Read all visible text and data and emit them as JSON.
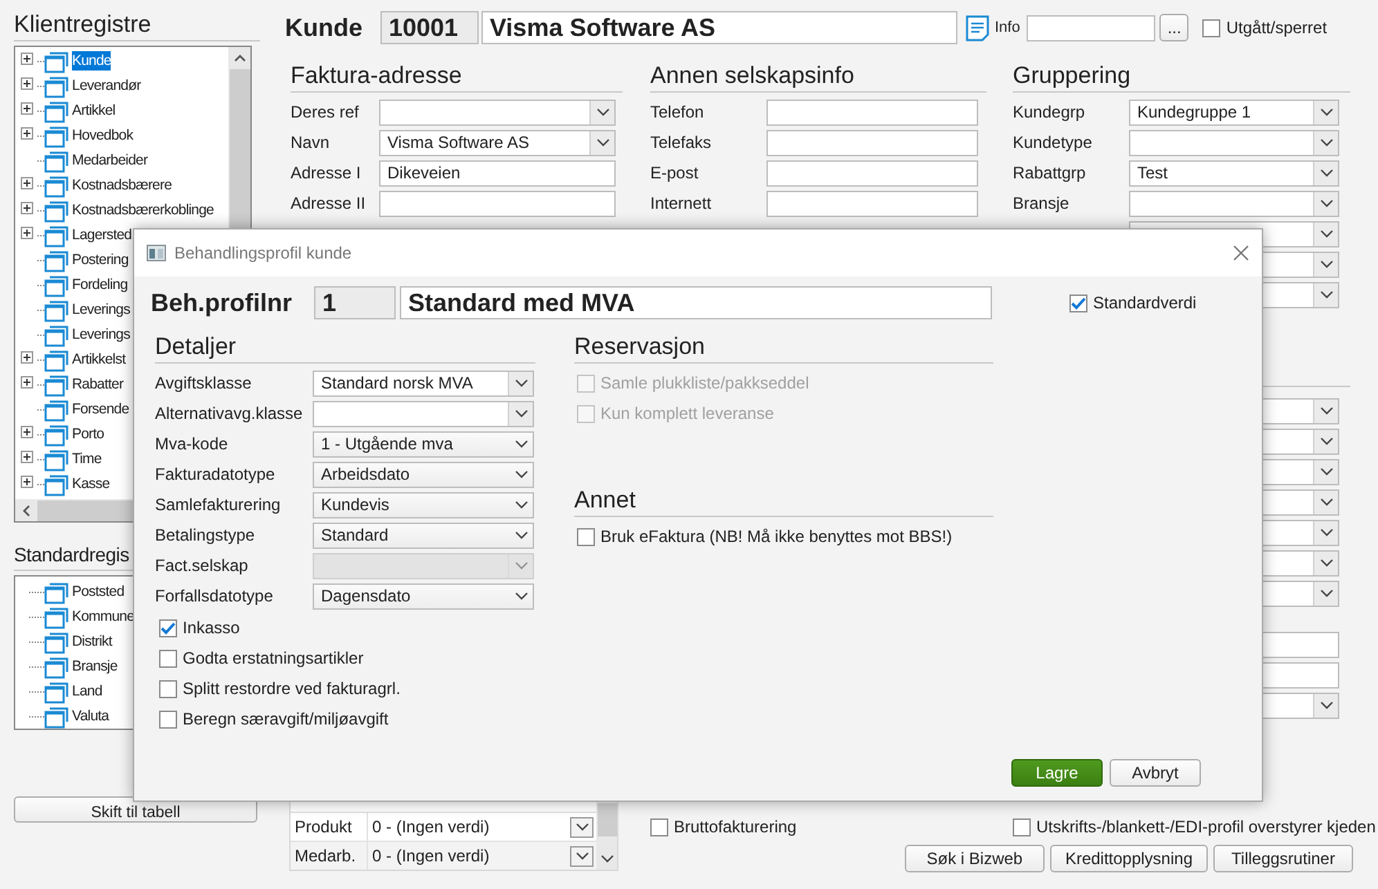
{
  "left_panel": {
    "heading": "Klientregistre",
    "tree": [
      {
        "label": "Kunde",
        "expandable": true,
        "selected": true
      },
      {
        "label": "Leverandør",
        "expandable": true,
        "selected": false
      },
      {
        "label": "Artikkel",
        "expandable": true,
        "selected": false
      },
      {
        "label": "Hovedbok",
        "expandable": true,
        "selected": false
      },
      {
        "label": "Medarbeider",
        "expandable": false,
        "selected": false
      },
      {
        "label": "Kostnadsbærere",
        "expandable": true,
        "selected": false
      },
      {
        "label": "Kostnadsbærerkoblinge",
        "expandable": true,
        "selected": false
      },
      {
        "label": "Lagersted",
        "expandable": true,
        "selected": false
      },
      {
        "label": "Postering",
        "expandable": false,
        "selected": false
      },
      {
        "label": "Fordeling",
        "expandable": false,
        "selected": false
      },
      {
        "label": "Leverings",
        "expandable": false,
        "selected": false
      },
      {
        "label": "Leverings",
        "expandable": false,
        "selected": false
      },
      {
        "label": "Artikkelst",
        "expandable": true,
        "selected": false
      },
      {
        "label": "Rabatter",
        "expandable": true,
        "selected": false
      },
      {
        "label": "Forsende",
        "expandable": false,
        "selected": false
      },
      {
        "label": "Porto",
        "expandable": true,
        "selected": false
      },
      {
        "label": "Time",
        "expandable": true,
        "selected": false
      },
      {
        "label": "Kasse",
        "expandable": true,
        "selected": false
      }
    ],
    "heading2": "Standardregis",
    "tree2": [
      {
        "label": "Poststed",
        "selected": false
      },
      {
        "label": "Kommune",
        "selected": false
      },
      {
        "label": "Distrikt",
        "selected": false
      },
      {
        "label": "Bransje",
        "selected": false
      },
      {
        "label": "Land",
        "selected": false
      },
      {
        "label": "Valuta",
        "selected": false
      }
    ],
    "switch_button": "Skift til tabell"
  },
  "customer": {
    "title": "Kunde",
    "number": "10001",
    "name": "Visma Software AS",
    "info_label": "Info",
    "info_button": "...",
    "blocked": {
      "label": "Utgått/sperret",
      "checked": false
    }
  },
  "invoice_address": {
    "heading": "Faktura-adresse",
    "rows": [
      {
        "label": "Deres ref",
        "kind": "combo"
      },
      {
        "label": "Navn",
        "value": "Visma Software AS",
        "kind": "combo"
      },
      {
        "label": "Adresse I",
        "value": "Dikeveien",
        "kind": "text"
      },
      {
        "label": "Adresse II",
        "kind": "text"
      }
    ]
  },
  "company_info": {
    "heading": "Annen selskapsinfo",
    "rows": [
      {
        "label": "Telefon",
        "kind": "text"
      },
      {
        "label": "Telefaks",
        "kind": "text"
      },
      {
        "label": "E-post",
        "kind": "text"
      },
      {
        "label": "Internett",
        "kind": "text"
      }
    ]
  },
  "grouping": {
    "heading": "Gruppering",
    "rows": [
      {
        "label": "Kundegrp",
        "value": "Kundegruppe 1",
        "kind": "combo"
      },
      {
        "label": "Kundetype",
        "kind": "combo"
      },
      {
        "label": "Rabattgrp",
        "value": "Test",
        "kind": "combo"
      },
      {
        "label": "Bransje",
        "kind": "combo"
      },
      {
        "kind": "combo"
      },
      {
        "kind": "combo"
      },
      {
        "kind": "combo"
      }
    ]
  },
  "lower_right_fields": [
    {
      "kind": "combo"
    },
    {
      "kind": "combo"
    },
    {
      "kind": "combo"
    },
    {
      "kind": "combo"
    },
    {
      "kind": "combo"
    },
    {
      "kind": "combo"
    },
    {
      "kind": "combo"
    },
    {
      "kind": "gap"
    },
    {
      "kind": "text"
    },
    {
      "kind": "text"
    },
    {
      "kind": "combo"
    }
  ],
  "dimension_table": {
    "rows": [
      {
        "label": "Produkt",
        "value": "0 - (Ingen verdi)"
      },
      {
        "label": "Medarb.",
        "value": "0 - (Ingen verdi)"
      }
    ]
  },
  "gross_invoicing": {
    "label": "Bruttofakturering",
    "checked": false
  },
  "print_profile_override": {
    "label": "Utskrifts-/blankett-/EDI-profil overstyrer kjeden",
    "checked": false
  },
  "buttons": [
    "Søk i Bizweb",
    "Kredittopplysning",
    "Tilleggsrutiner"
  ],
  "dialog": {
    "title": "Behandlingsprofil kunde",
    "profile_label": "Beh.profilnr",
    "profile_number": "1",
    "profile_name": "Standard med MVA",
    "default_value": {
      "label": "Standardverdi",
      "checked": true
    },
    "details": {
      "heading": "Detaljer",
      "rows": [
        {
          "label": "Avgiftsklasse",
          "value": "Standard norsk MVA",
          "kind": "editable",
          "disabled": false
        },
        {
          "label": "Alternativavg.klasse",
          "kind": "editable",
          "disabled": false
        },
        {
          "label": "Mva-kode",
          "value": "1 - Utgående mva",
          "kind": "list",
          "disabled": false
        },
        {
          "label": "Fakturadatotype",
          "value": "Arbeidsdato",
          "kind": "list",
          "disabled": false
        },
        {
          "label": "Samlefakturering",
          "value": "Kundevis",
          "kind": "list",
          "disabled": false
        },
        {
          "label": "Betalingstype",
          "value": "Standard",
          "kind": "list",
          "disabled": false
        },
        {
          "label": "Fact.selskap",
          "kind": "editable",
          "disabled": true
        },
        {
          "label": "Forfallsdatotype",
          "value": "Dagensdato",
          "kind": "list",
          "disabled": false
        }
      ],
      "checkboxes": [
        {
          "label": "Inkasso",
          "checked": true
        },
        {
          "label": "Godta erstatningsartikler",
          "checked": false
        },
        {
          "label": "Splitt restordre ved fakturagrl.",
          "checked": false
        },
        {
          "label": "Beregn særavgift/miljøavgift",
          "checked": false
        }
      ]
    },
    "reservation": {
      "heading": "Reservasjon",
      "checkboxes": [
        {
          "label": "Samle plukkliste/pakkseddel",
          "checked": false,
          "disabled": true
        },
        {
          "label": "Kun komplett leveranse",
          "checked": false,
          "disabled": true
        }
      ]
    },
    "other": {
      "heading": "Annet",
      "checkboxes": [
        {
          "label": "Bruk eFaktura (NB! Må ikke benyttes mot BBS!)",
          "checked": false,
          "disabled": false
        }
      ]
    },
    "buttons": [
      {
        "label": "Lagre",
        "kind": "primary"
      },
      {
        "label": "Avbryt",
        "kind": "secondary"
      }
    ]
  }
}
